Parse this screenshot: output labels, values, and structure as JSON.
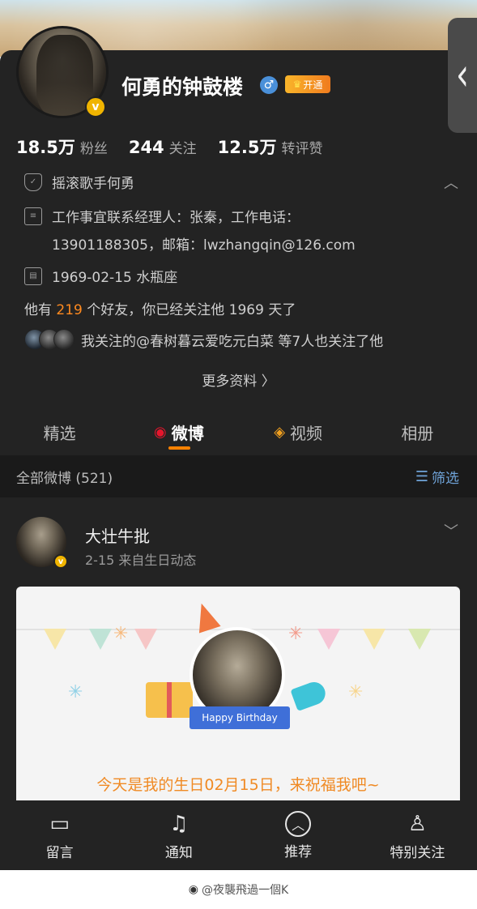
{
  "profile": {
    "name": "何勇的钟鼓楼",
    "vip_label": "开通",
    "stats": [
      {
        "num": "18.5万",
        "label": "粉丝"
      },
      {
        "num": "244",
        "label": "关注"
      },
      {
        "num": "12.5万",
        "label": "转评赞"
      }
    ],
    "verification": "摇滚歌手何勇",
    "contact_line1": "工作事宜联系经理人：张秦，工作电话：",
    "contact_line2": "13901188305，邮箱：lwzhangqin@126.com",
    "birthday": "1969-02-15 水瓶座",
    "friends_prefix": "他有 ",
    "friends_count": "219",
    "friends_suffix": " 个好友，你已经关注他 1969 天了",
    "mutual_text": "我关注的@春树暮云爱吃元白菜 等7人也关注了他",
    "more_info": "更多资料 〉"
  },
  "tabs": [
    {
      "label": "精选",
      "icon": ""
    },
    {
      "label": "微博",
      "icon": "weibo-icon"
    },
    {
      "label": "视频",
      "icon": "video-icon"
    },
    {
      "label": "相册",
      "icon": ""
    }
  ],
  "active_tab": "微博",
  "list_header": {
    "title": "全部微博 (521)",
    "filter_label": "筛选"
  },
  "post": {
    "author": "大壮牛批",
    "meta": "2-15  来自生日动态",
    "ribbon_text": "Happy Birthday",
    "birthday_text": "今天是我的生日02月15日，来祝福我吧~"
  },
  "bottom_bar": [
    {
      "label": "留言",
      "icon": "message-icon"
    },
    {
      "label": "通知",
      "icon": "bell-icon"
    },
    {
      "label": "推荐",
      "icon": "recommend-icon"
    },
    {
      "label": "特别关注",
      "icon": "special-follow-icon"
    }
  ],
  "watermark": "@夜襲飛過一個K",
  "colors": {
    "accent_orange": "#ff8200",
    "highlight": "#ff8a1f",
    "link_blue": "#6fa3d8",
    "card_bg": "#232323"
  }
}
